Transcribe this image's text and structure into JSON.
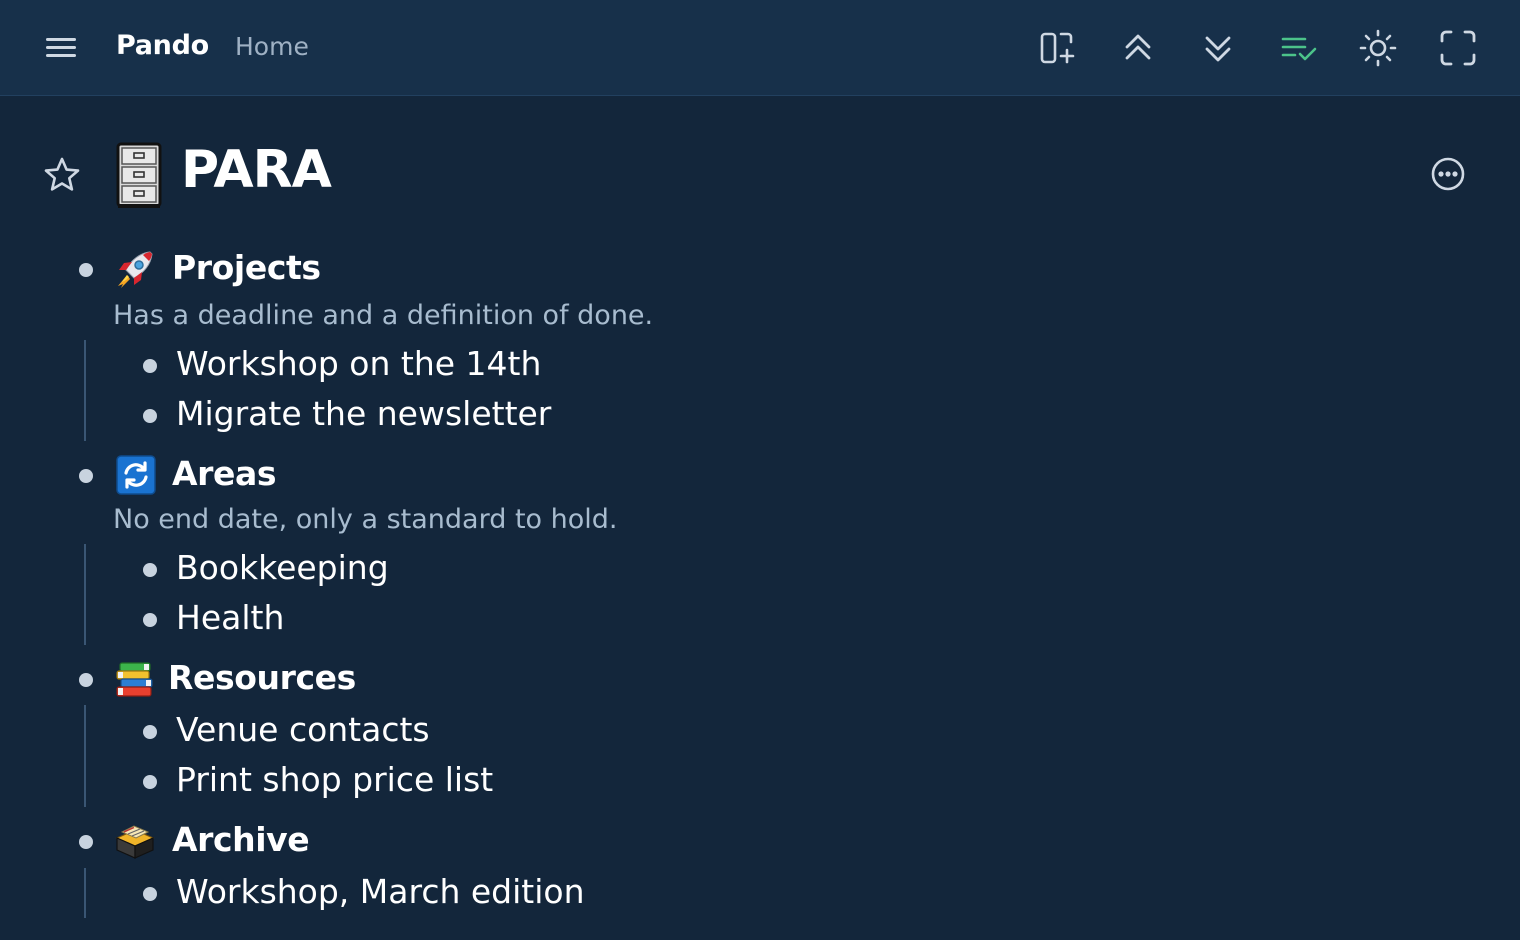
{
  "app": {
    "name": "Pando",
    "breadcrumb": "Home"
  },
  "toolbar": {
    "icons": [
      "add-panel-icon",
      "collapse-all-icon",
      "expand-all-icon",
      "checklist-icon",
      "brightness-icon",
      "fullscreen-icon"
    ],
    "checklist_color": "#4cc38a"
  },
  "page": {
    "icon": "file-cabinet-icon",
    "title": "PARA"
  },
  "outline": {
    "projects": {
      "icon": "rocket-icon",
      "title": "Projects",
      "note": "Has a deadline and a definition of done.",
      "children": [
        "Workshop on the 14th",
        "Migrate the newsletter"
      ]
    },
    "areas": {
      "icon": "refresh-icon",
      "title": "Areas",
      "note": "No end date, only a standard to hold.",
      "children": [
        "Bookkeeping",
        "Health"
      ]
    },
    "resources": {
      "icon": "books-icon",
      "title": "Resources",
      "children": [
        "Venue contacts",
        "Print shop price list"
      ]
    },
    "archive": {
      "icon": "archive-box-icon",
      "title": "Archive",
      "children": [
        "Workshop, March edition"
      ]
    }
  }
}
